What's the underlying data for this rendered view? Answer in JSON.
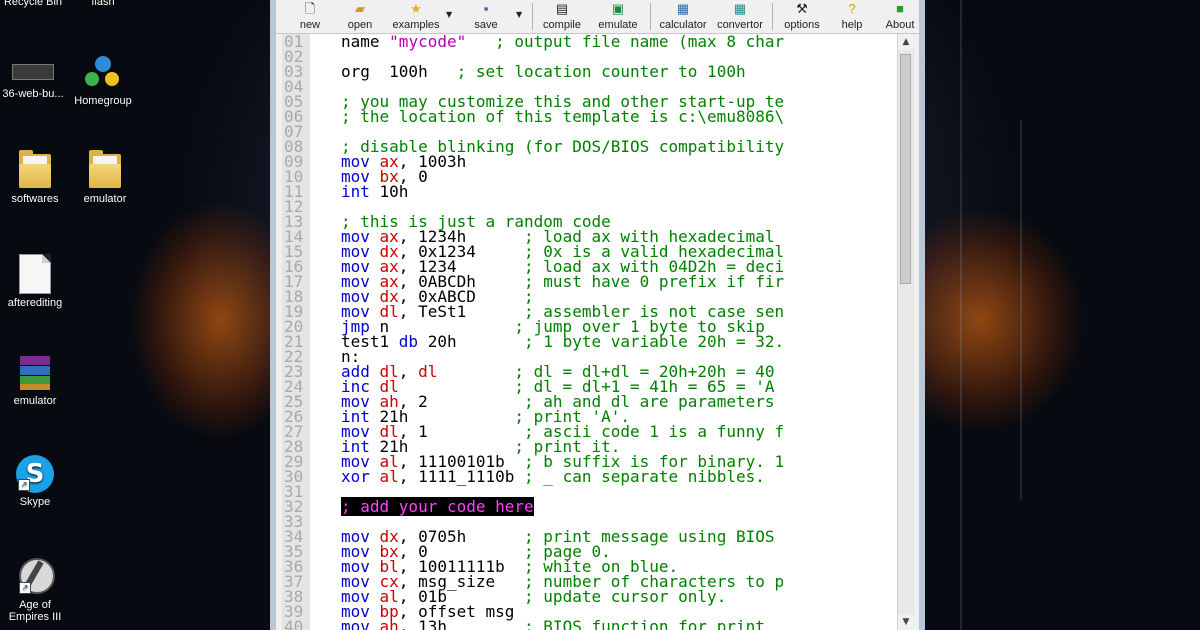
{
  "desktop": {
    "icons_left": [
      {
        "label": "Recycle Bin",
        "icon": "recycle-bin-icon"
      },
      {
        "label": "36-web-bu...",
        "icon": "drive-icon"
      },
      {
        "label": "softwares",
        "icon": "folder-icon"
      },
      {
        "label": "afterediting",
        "icon": "document-icon"
      },
      {
        "label": "emulator",
        "icon": "winrar-icon"
      },
      {
        "label": "Skype",
        "icon": "skype-icon"
      },
      {
        "label": "Age of Empires III",
        "icon": "age-of-empires-icon"
      }
    ],
    "icons_right": [
      {
        "label": "flash",
        "icon": "flash-icon"
      },
      {
        "label": "Homegroup",
        "icon": "homegroup-icon"
      },
      {
        "label": "emulator",
        "icon": "folder-icon"
      }
    ],
    "age_line1": "Age of",
    "age_line2": "Empires III"
  },
  "toolbar": {
    "buttons": [
      {
        "label": "new",
        "icon": "new-file-icon"
      },
      {
        "label": "open",
        "icon": "open-folder-icon"
      },
      {
        "label": "examples",
        "icon": "star-icon"
      },
      {
        "label": "save",
        "icon": "save-icon"
      },
      {
        "label": "compile",
        "icon": "compile-icon"
      },
      {
        "label": "emulate",
        "icon": "emulate-icon"
      },
      {
        "label": "calculator",
        "icon": "calculator-icon"
      },
      {
        "label": "convertor",
        "icon": "convertor-icon"
      },
      {
        "label": "options",
        "icon": "options-icon"
      },
      {
        "label": "help",
        "icon": "help-icon"
      },
      {
        "label": "About",
        "icon": "about-icon"
      }
    ]
  },
  "colors": {
    "keyword": "#0000cc",
    "register": "#cc0000",
    "comment": "#008000",
    "string": "#b000b0",
    "highlight_fg": "#ff40ff",
    "highlight_bg": "#000000"
  },
  "editor": {
    "lines": [
      {
        "n": "01",
        "tokens": [
          [
            "plain",
            "name "
          ],
          [
            "str",
            "\"mycode\""
          ],
          [
            "com",
            "   ; output file name (max 8 char"
          ]
        ]
      },
      {
        "n": "02",
        "tokens": []
      },
      {
        "n": "03",
        "tokens": [
          [
            "plain",
            "org  100h"
          ],
          [
            "com",
            "   ; set location counter to 100h"
          ]
        ]
      },
      {
        "n": "04",
        "tokens": []
      },
      {
        "n": "05",
        "tokens": [
          [
            "com",
            "; you may customize this and other start-up te"
          ]
        ]
      },
      {
        "n": "06",
        "tokens": [
          [
            "com",
            "; the location of this template is c:\\emu8086\\"
          ]
        ]
      },
      {
        "n": "07",
        "tokens": []
      },
      {
        "n": "08",
        "tokens": [
          [
            "com",
            "; disable blinking (for DOS/BIOS compatibility"
          ]
        ]
      },
      {
        "n": "09",
        "tokens": [
          [
            "kw",
            "mov "
          ],
          [
            "reg",
            "ax"
          ],
          [
            "plain",
            ", 1003h"
          ]
        ]
      },
      {
        "n": "10",
        "tokens": [
          [
            "kw",
            "mov "
          ],
          [
            "reg",
            "bx"
          ],
          [
            "plain",
            ", 0"
          ]
        ]
      },
      {
        "n": "11",
        "tokens": [
          [
            "kw",
            "int "
          ],
          [
            "plain",
            "10h"
          ]
        ]
      },
      {
        "n": "12",
        "tokens": []
      },
      {
        "n": "13",
        "tokens": [
          [
            "com",
            "; this is just a random code"
          ]
        ]
      },
      {
        "n": "14",
        "tokens": [
          [
            "kw",
            "mov "
          ],
          [
            "reg",
            "ax"
          ],
          [
            "plain",
            ", 1234h      "
          ],
          [
            "com",
            "; load ax with hexadecimal"
          ]
        ]
      },
      {
        "n": "15",
        "tokens": [
          [
            "kw",
            "mov "
          ],
          [
            "reg",
            "dx"
          ],
          [
            "plain",
            ", 0x1234     "
          ],
          [
            "com",
            "; 0x is a valid hexadecimal"
          ]
        ]
      },
      {
        "n": "16",
        "tokens": [
          [
            "kw",
            "mov "
          ],
          [
            "reg",
            "ax"
          ],
          [
            "plain",
            ", 1234       "
          ],
          [
            "com",
            "; load ax with 04D2h = deci"
          ]
        ]
      },
      {
        "n": "17",
        "tokens": [
          [
            "kw",
            "mov "
          ],
          [
            "reg",
            "ax"
          ],
          [
            "plain",
            ", 0ABCDh     "
          ],
          [
            "com",
            "; must have 0 prefix if fir"
          ]
        ]
      },
      {
        "n": "18",
        "tokens": [
          [
            "kw",
            "mov "
          ],
          [
            "reg",
            "dx"
          ],
          [
            "plain",
            ", 0xABCD     "
          ],
          [
            "com",
            ";"
          ]
        ]
      },
      {
        "n": "19",
        "tokens": [
          [
            "kw",
            "mov "
          ],
          [
            "reg",
            "dl"
          ],
          [
            "plain",
            ", TeSt1      "
          ],
          [
            "com",
            "; assembler is not case sen"
          ]
        ]
      },
      {
        "n": "20",
        "tokens": [
          [
            "kw",
            "jmp "
          ],
          [
            "plain",
            "n             "
          ],
          [
            "com",
            "; jump over 1 byte to skip"
          ]
        ]
      },
      {
        "n": "21",
        "tokens": [
          [
            "plain",
            "test1 "
          ],
          [
            "kw",
            "db"
          ],
          [
            "plain",
            " 20h       "
          ],
          [
            "com",
            "; 1 byte variable 20h = 32."
          ]
        ]
      },
      {
        "n": "22",
        "tokens": [
          [
            "plain",
            "n:"
          ]
        ]
      },
      {
        "n": "23",
        "tokens": [
          [
            "kw",
            "add "
          ],
          [
            "reg",
            "dl"
          ],
          [
            "plain",
            ", "
          ],
          [
            "reg",
            "dl"
          ],
          [
            "plain",
            "        "
          ],
          [
            "com",
            "; dl = dl+dl = 20h+20h = 40"
          ]
        ]
      },
      {
        "n": "24",
        "tokens": [
          [
            "kw",
            "inc "
          ],
          [
            "reg",
            "dl"
          ],
          [
            "plain",
            "            "
          ],
          [
            "com",
            "; dl = dl+1 = 41h = 65 = 'A"
          ]
        ]
      },
      {
        "n": "25",
        "tokens": [
          [
            "kw",
            "mov "
          ],
          [
            "reg",
            "ah"
          ],
          [
            "plain",
            ", 2          "
          ],
          [
            "com",
            "; ah and dl are parameters"
          ]
        ]
      },
      {
        "n": "26",
        "tokens": [
          [
            "kw",
            "int "
          ],
          [
            "plain",
            "21h           "
          ],
          [
            "com",
            "; print 'A'."
          ]
        ]
      },
      {
        "n": "27",
        "tokens": [
          [
            "kw",
            "mov "
          ],
          [
            "reg",
            "dl"
          ],
          [
            "plain",
            ", 1          "
          ],
          [
            "com",
            "; ascii code 1 is a funny f"
          ]
        ]
      },
      {
        "n": "28",
        "tokens": [
          [
            "kw",
            "int "
          ],
          [
            "plain",
            "21h           "
          ],
          [
            "com",
            "; print it."
          ]
        ]
      },
      {
        "n": "29",
        "tokens": [
          [
            "kw",
            "mov "
          ],
          [
            "reg",
            "al"
          ],
          [
            "plain",
            ", 11100101b  "
          ],
          [
            "com",
            "; b suffix is for binary. 1"
          ]
        ]
      },
      {
        "n": "30",
        "tokens": [
          [
            "kw",
            "xor "
          ],
          [
            "reg",
            "al"
          ],
          [
            "plain",
            ", 1111_1110b "
          ],
          [
            "com",
            "; _ can separate nibbles."
          ]
        ]
      },
      {
        "n": "31",
        "tokens": []
      },
      {
        "n": "32",
        "tokens": [
          [
            "hl",
            "; add your code here"
          ]
        ]
      },
      {
        "n": "33",
        "tokens": []
      },
      {
        "n": "34",
        "tokens": [
          [
            "kw",
            "mov "
          ],
          [
            "reg",
            "dx"
          ],
          [
            "plain",
            ", 0705h      "
          ],
          [
            "com",
            "; print message using BIOS"
          ]
        ]
      },
      {
        "n": "35",
        "tokens": [
          [
            "kw",
            "mov "
          ],
          [
            "reg",
            "bx"
          ],
          [
            "plain",
            ", 0          "
          ],
          [
            "com",
            "; page 0."
          ]
        ]
      },
      {
        "n": "36",
        "tokens": [
          [
            "kw",
            "mov "
          ],
          [
            "reg",
            "bl"
          ],
          [
            "plain",
            ", 10011111b  "
          ],
          [
            "com",
            "; white on blue."
          ]
        ]
      },
      {
        "n": "37",
        "tokens": [
          [
            "kw",
            "mov "
          ],
          [
            "reg",
            "cx"
          ],
          [
            "plain",
            ", msg_size   "
          ],
          [
            "com",
            "; number of characters to p"
          ]
        ]
      },
      {
        "n": "38",
        "tokens": [
          [
            "kw",
            "mov "
          ],
          [
            "reg",
            "al"
          ],
          [
            "plain",
            ", 01b        "
          ],
          [
            "com",
            "; update cursor only."
          ]
        ]
      },
      {
        "n": "39",
        "tokens": [
          [
            "kw",
            "mov "
          ],
          [
            "reg",
            "bp"
          ],
          [
            "plain",
            ", offset msg"
          ]
        ]
      },
      {
        "n": "40",
        "tokens": [
          [
            "kw",
            "mov "
          ],
          [
            "reg",
            "ah"
          ],
          [
            "plain",
            ", 13h        "
          ],
          [
            "com",
            "; BIOS function for print"
          ]
        ]
      }
    ]
  }
}
